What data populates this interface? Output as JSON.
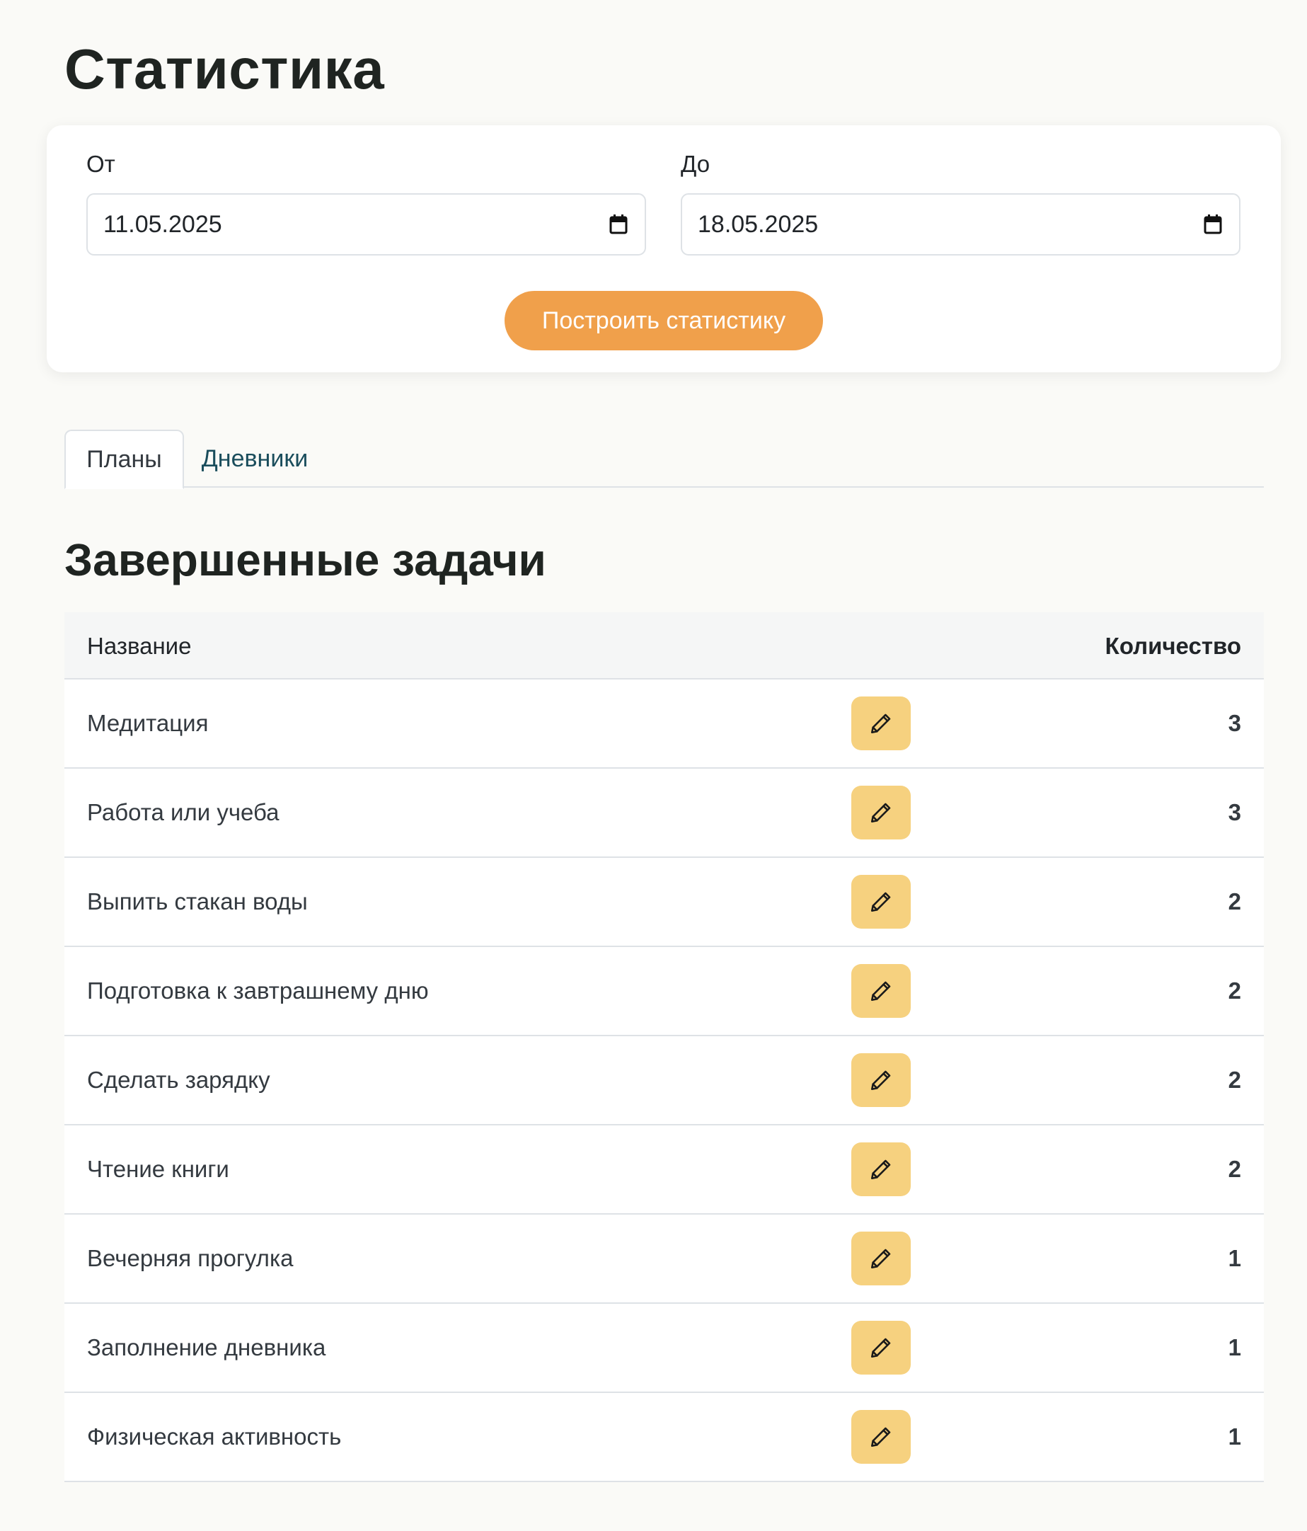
{
  "page": {
    "title": "Статистика"
  },
  "filters": {
    "from_label": "От",
    "from_value": "11.05.2025",
    "to_label": "До",
    "to_value": "18.05.2025",
    "build_button_label": "Построить статистику",
    "accent_color": "#f0a04b"
  },
  "tabs": [
    {
      "label": "Планы",
      "active": true
    },
    {
      "label": "Дневники",
      "active": false
    }
  ],
  "section": {
    "title": "Завершенные задачи"
  },
  "table": {
    "columns": [
      "Название",
      "Количество"
    ],
    "rows": [
      {
        "name": "Медитация",
        "count": "3",
        "action_icon": "pencil-icon"
      },
      {
        "name": "Работа или учеба",
        "count": "3",
        "action_icon": "pencil-icon"
      },
      {
        "name": "Выпить стакан воды",
        "count": "2",
        "action_icon": "pencil-icon"
      },
      {
        "name": "Подготовка к завтрашнему дню",
        "count": "2",
        "action_icon": "pencil-icon"
      },
      {
        "name": "Сделать зарядку",
        "count": "2",
        "action_icon": "pencil-icon"
      },
      {
        "name": "Чтение книги",
        "count": "2",
        "action_icon": "pencil-icon"
      },
      {
        "name": "Вечерняя прогулка",
        "count": "1",
        "action_icon": "pencil-icon"
      },
      {
        "name": "Заполнение дневника",
        "count": "1",
        "action_icon": "pencil-icon"
      },
      {
        "name": "Физическая активность",
        "count": "1",
        "action_icon": "pencil-icon"
      }
    ],
    "edit_button_color": "#f6d17f"
  }
}
